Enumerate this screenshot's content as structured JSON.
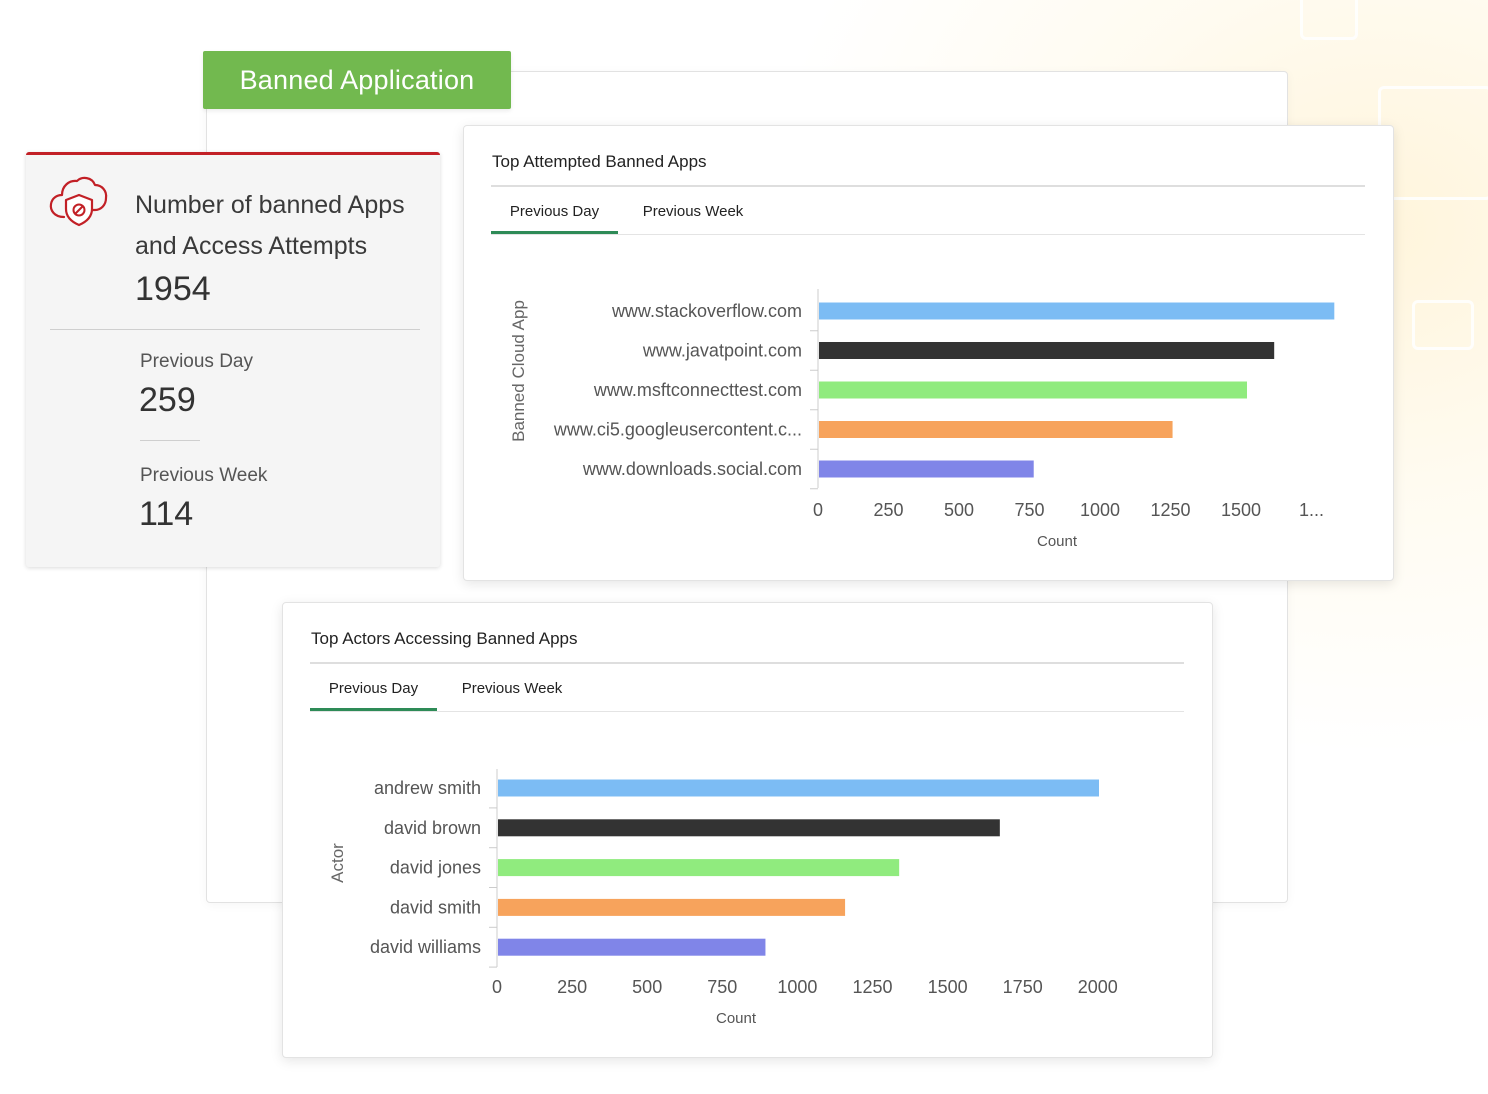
{
  "banner": {
    "title": "Banned Application"
  },
  "stats": {
    "title": "Number of banned Apps and Access Attempts",
    "total": "1954",
    "previous_day_label": "Previous Day",
    "previous_day_value": "259",
    "previous_week_label": "Previous Week",
    "previous_week_value": "114",
    "icon": "cloud-shield-icon",
    "accent_color": "#c22026"
  },
  "apps_card": {
    "title": "Top Attempted Banned Apps",
    "tabs": [
      {
        "label": "Previous Day",
        "active": true
      },
      {
        "label": "Previous Week",
        "active": false
      }
    ]
  },
  "actors_card": {
    "title": "Top Actors Accessing Banned Apps",
    "tabs": [
      {
        "label": "Previous Day",
        "active": true
      },
      {
        "label": "Previous Week",
        "active": false
      }
    ]
  },
  "colors": {
    "banner": "#72b94f",
    "tab_active": "#2e8b57"
  },
  "chart_data": [
    {
      "type": "bar",
      "orientation": "horizontal",
      "categories": [
        "www.stackoverflow.com",
        "www.javatpoint.com",
        "www.msftconnecttest.com",
        "www.ci5.googleusercontent.c...",
        "www.downloads.social.com"
      ],
      "values": [
        1800,
        1590,
        1495,
        1235,
        750
      ],
      "colors": [
        "#7cbcf4",
        "#333333",
        "#90eb7e",
        "#f7a35c",
        "#8085e8"
      ],
      "xlabel": "Count",
      "ylabel": "Banned Cloud App",
      "xticks": [
        "0",
        "250",
        "500",
        "750",
        "1000",
        "1250",
        "1500",
        "1..."
      ],
      "xlim": [
        0,
        1750
      ],
      "grid": false,
      "legend": "none"
    },
    {
      "type": "bar",
      "orientation": "horizontal",
      "categories": [
        "andrew smith",
        "david brown",
        "david jones",
        "david smith",
        "david williams"
      ],
      "values": [
        2000,
        1670,
        1335,
        1155,
        890
      ],
      "colors": [
        "#7cbcf4",
        "#333333",
        "#90eb7e",
        "#f7a35c",
        "#8085e8"
      ],
      "xlabel": "Count",
      "ylabel": "Actor",
      "xticks": [
        "0",
        "250",
        "500",
        "750",
        "1000",
        "1250",
        "1500",
        "1750",
        "2000"
      ],
      "xlim": [
        0,
        2000
      ],
      "grid": false,
      "legend": "none"
    }
  ]
}
